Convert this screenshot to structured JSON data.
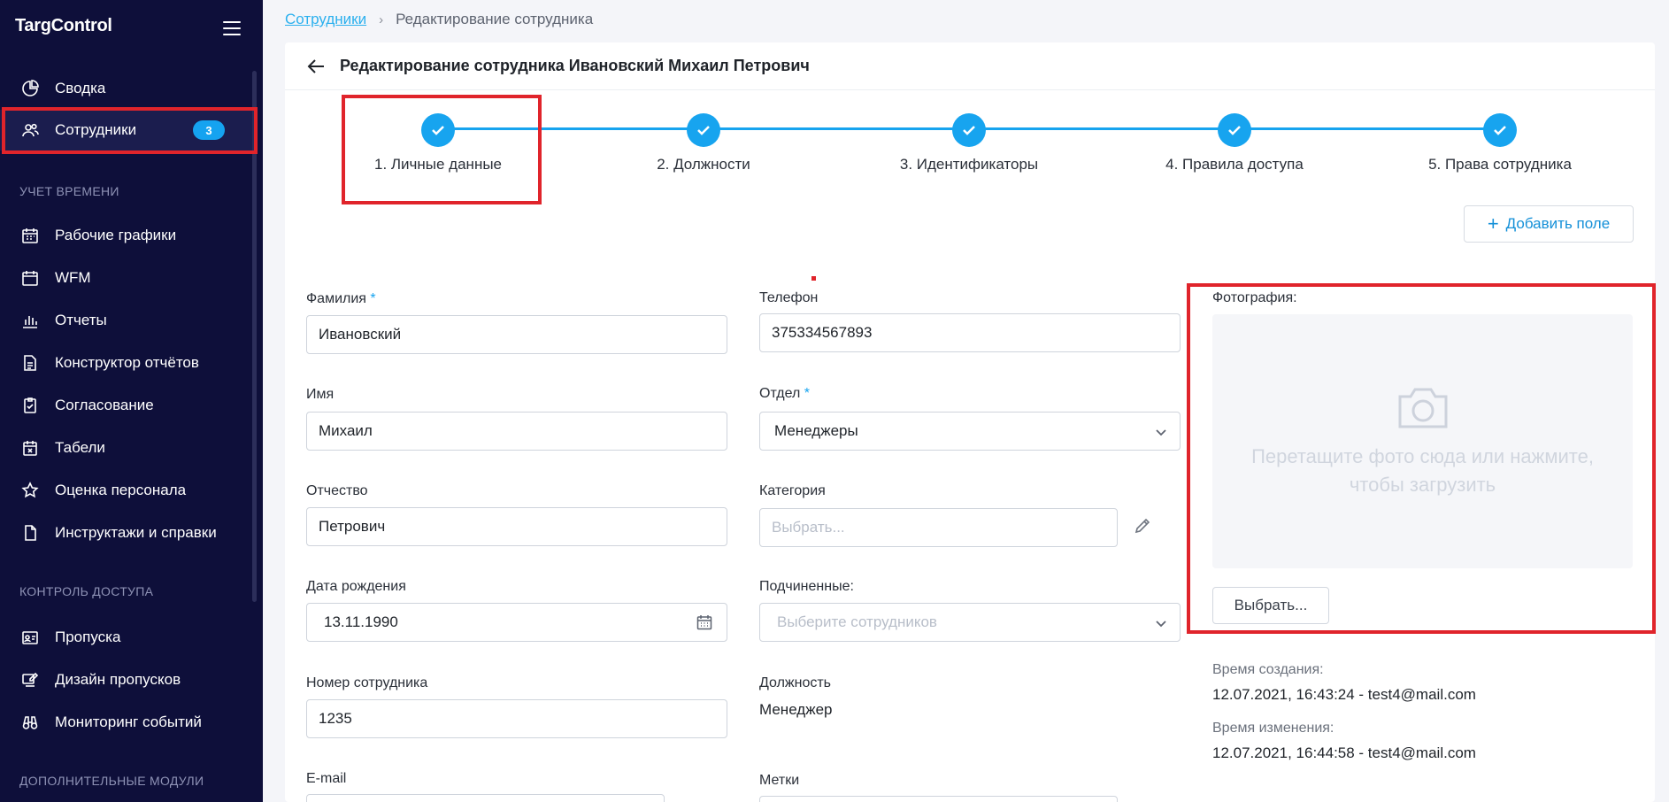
{
  "app": {
    "brand": "TargControl"
  },
  "sidebar": {
    "items": [
      {
        "label": "Сводка",
        "icon": "pie-chart-icon"
      },
      {
        "label": "Сотрудники",
        "icon": "users-icon",
        "badge": "3",
        "active": true
      }
    ],
    "section_time": "УЧЕТ ВРЕМЕНИ",
    "time_items": [
      {
        "label": "Рабочие графики",
        "icon": "calendar-icon"
      },
      {
        "label": "WFM",
        "icon": "calendar-icon"
      },
      {
        "label": "Отчеты",
        "icon": "bar-chart-icon"
      },
      {
        "label": "Конструктор отчётов",
        "icon": "document-icon"
      },
      {
        "label": "Согласование",
        "icon": "clipboard-check-icon"
      },
      {
        "label": "Табели",
        "icon": "calendar-x-icon"
      },
      {
        "label": "Оценка персонала",
        "icon": "star-icon"
      },
      {
        "label": "Инструктажи и справки",
        "icon": "file-icon"
      }
    ],
    "section_access": "КОНТРОЛЬ ДОСТУПА",
    "access_items": [
      {
        "label": "Пропуска",
        "icon": "id-card-icon"
      },
      {
        "label": "Дизайн пропусков",
        "icon": "design-icon"
      },
      {
        "label": "Мониторинг событий",
        "icon": "binoculars-icon"
      }
    ],
    "section_extra": "ДОПОЛНИТЕЛЬНЫЕ МОДУЛИ"
  },
  "breadcrumb": {
    "link": "Сотрудники",
    "current": "Редактирование сотрудника"
  },
  "page": {
    "title": "Редактирование сотрудника Ивановский Михаил Петрович"
  },
  "steps": [
    {
      "label": "1. Личные данные"
    },
    {
      "label": "2. Должности"
    },
    {
      "label": "3. Идентификаторы"
    },
    {
      "label": "4. Правила доступа"
    },
    {
      "label": "5. Права сотрудника"
    }
  ],
  "add_field_label": "Добавить поле",
  "form": {
    "last_name": {
      "label": "Фамилия",
      "value": "Ивановский"
    },
    "first_name": {
      "label": "Имя",
      "value": "Михаил"
    },
    "middle_name": {
      "label": "Отчество",
      "value": "Петрович"
    },
    "birth_date": {
      "label": "Дата рождения",
      "value": "13.11.1990"
    },
    "employee_number": {
      "label": "Номер сотрудника",
      "value": "1235"
    },
    "email": {
      "label": "E-mail"
    },
    "phone": {
      "label": "Телефон",
      "value": "375334567893"
    },
    "department": {
      "label": "Отдел",
      "value": "Менеджеры"
    },
    "category": {
      "label": "Категория",
      "placeholder": "Выбрать..."
    },
    "subordinates": {
      "label": "Подчиненные:",
      "placeholder": "Выберите сотрудников"
    },
    "position": {
      "label": "Должность",
      "value": "Менеджер"
    },
    "tags": {
      "label": "Метки"
    }
  },
  "photo": {
    "label": "Фотография:",
    "dropzone_text": "Перетащите фото сюда или нажмите, чтобы загрузить",
    "choose_button": "Выбрать..."
  },
  "meta": {
    "created_label": "Время создания:",
    "created_value": "12.07.2021, 16:43:24 - test4@mail.com",
    "modified_label": "Время изменения:",
    "modified_value": "12.07.2021, 16:44:58 - test4@mail.com"
  },
  "colors": {
    "sidebar_bg": "#0e0f3a",
    "accent": "#17a4ef",
    "highlight": "#e0242b"
  }
}
